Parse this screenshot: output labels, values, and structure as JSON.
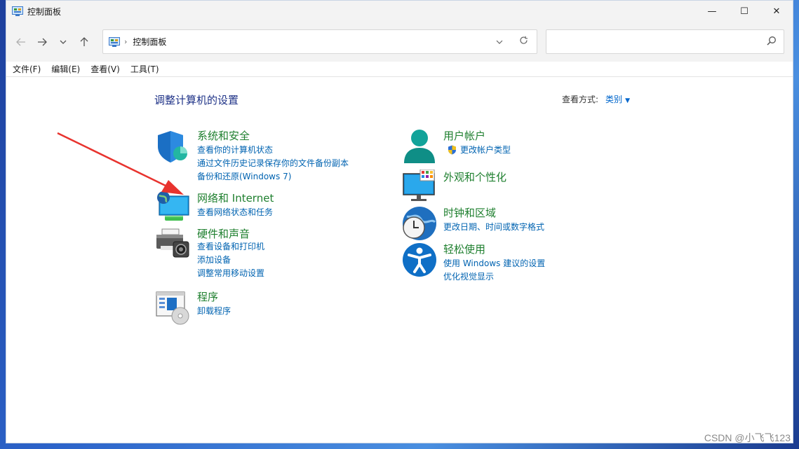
{
  "window": {
    "title": "控制面板"
  },
  "titlebar": {
    "minimize": "—",
    "maximize": "☐",
    "close": "✕"
  },
  "address": {
    "path": "控制面板",
    "separator": "›"
  },
  "search": {
    "placeholder": ""
  },
  "menu": [
    "文件(F)",
    "编辑(E)",
    "查看(V)",
    "工具(T)"
  ],
  "page": {
    "heading": "调整计算机的设置",
    "view_by_label": "查看方式:",
    "view_by_value": "类别"
  },
  "categories": {
    "system": {
      "title": "系统和安全",
      "links": [
        "查看你的计算机状态",
        "通过文件历史记录保存你的文件备份副本",
        "备份和还原(Windows 7)"
      ]
    },
    "network": {
      "title": "网络和 Internet",
      "links": [
        "查看网络状态和任务"
      ]
    },
    "hardware": {
      "title": "硬件和声音",
      "links": [
        "查看设备和打印机",
        "添加设备",
        "调整常用移动设置"
      ]
    },
    "programs": {
      "title": "程序",
      "links": [
        "卸载程序"
      ]
    },
    "users": {
      "title": "用户帐户",
      "links": [
        "更改帐户类型"
      ]
    },
    "appearance": {
      "title": "外观和个性化",
      "links": []
    },
    "clock": {
      "title": "时钟和区域",
      "links": [
        "更改日期、时间或数字格式"
      ]
    },
    "ease": {
      "title": "轻松使用",
      "links": [
        "使用 Windows 建议的设置",
        "优化视觉显示"
      ]
    }
  },
  "watermark": "CSDN @小飞飞123",
  "colors": {
    "link": "#0063b1",
    "category_title": "#1e7f2e",
    "heading": "#1e3287",
    "annotation_arrow": "#e8332e"
  }
}
